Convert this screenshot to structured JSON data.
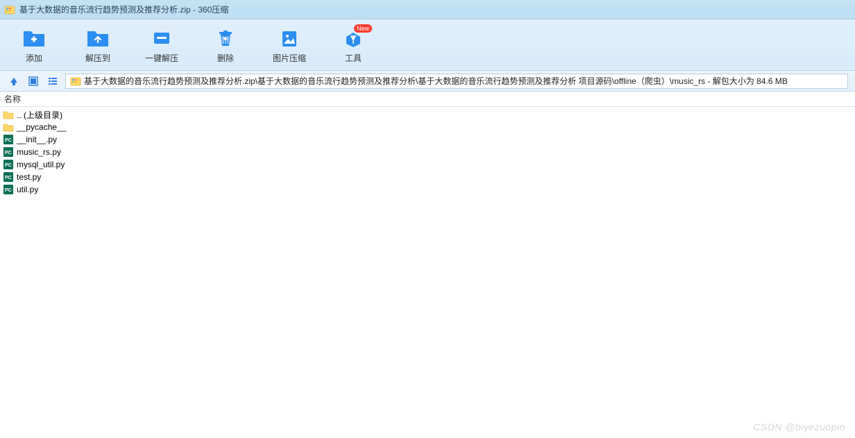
{
  "window": {
    "title": "基于大数据的音乐流行趋势预测及推荐分析.zip - 360压缩"
  },
  "toolbar": {
    "add": "添加",
    "extract_to": "解压到",
    "one_click_extract": "一键解压",
    "delete": "删除",
    "image_compress": "图片压缩",
    "tools": "工具",
    "new_badge": "New"
  },
  "pathbar": {
    "path": "基于大数据的音乐流行趋势预测及推荐分析.zip\\基于大数据的音乐流行趋势预测及推荐分析\\基于大数据的音乐流行趋势预测及推荐分析 项目源码\\offline（爬虫）\\music_rs - 解包大小为 84.6 MB"
  },
  "columns": {
    "name": "名称"
  },
  "files": [
    {
      "name": ".. (上级目录)",
      "type": "folder-up"
    },
    {
      "name": "__pycache__",
      "type": "folder"
    },
    {
      "name": "__init__.py",
      "type": "py"
    },
    {
      "name": "music_rs.py",
      "type": "py"
    },
    {
      "name": "mysql_util.py",
      "type": "py"
    },
    {
      "name": "test.py",
      "type": "py"
    },
    {
      "name": "util.py",
      "type": "py"
    }
  ],
  "watermark": "CSDN @biyezuopin",
  "colors": {
    "toolbar_icon_blue": "#2c8ef0",
    "toolbar_bg_top": "#e0eefb"
  }
}
